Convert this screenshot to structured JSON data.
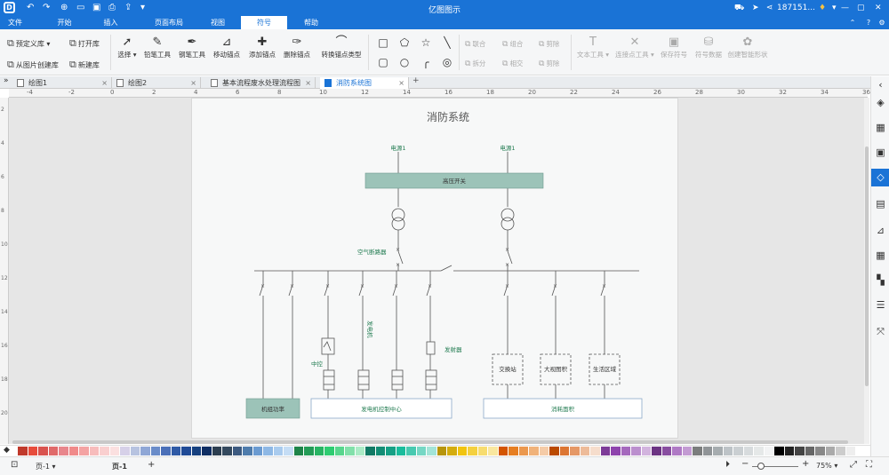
{
  "app": {
    "title": "亿图图示",
    "user": "187151..."
  },
  "menu": [
    "文件",
    "开始",
    "插入",
    "页面布局",
    "视图",
    "符号",
    "帮助"
  ],
  "ribbon": {
    "library": {
      "predefined": "预定义库",
      "open": "打开库",
      "from_image": "从图片创建库",
      "new": "新建库"
    },
    "tools": [
      {
        "label": "选择",
        "icon": "pointer-icon"
      },
      {
        "label": "铅笔工具",
        "icon": "pencil-icon"
      },
      {
        "label": "钢笔工具",
        "icon": "pen-icon"
      },
      {
        "label": "移动锚点",
        "icon": "move-anchor-icon"
      },
      {
        "label": "添加锚点",
        "icon": "add-anchor-icon"
      },
      {
        "label": "删除锚点",
        "icon": "delete-anchor-icon"
      },
      {
        "label": "转换锚点类型",
        "icon": "convert-anchor-icon"
      }
    ],
    "geometry": [
      "联合",
      "组合",
      "剪除",
      "拆分",
      "相交",
      "剪除"
    ],
    "text_tool": "文本工具",
    "connection_tool": "连接点工具",
    "save_symbol": "保存符号",
    "symbol_data": "符号数据",
    "smart_shape": "创建智能形状"
  },
  "tabs": [
    "绘图1",
    "绘图2",
    "基本流程废水处理流程图",
    "消防系统图"
  ],
  "ruler_h": [
    "-4",
    "-2",
    "0",
    "2",
    "4",
    "6",
    "8",
    "10",
    "12",
    "14",
    "16",
    "18",
    "20",
    "22",
    "24",
    "26",
    "28",
    "30",
    "32",
    "34",
    "36"
  ],
  "ruler_v": [
    "2",
    "4",
    "6",
    "8",
    "10",
    "12",
    "14",
    "16",
    "18",
    "20"
  ],
  "diagram": {
    "title": "消防系统",
    "source1": "电源1",
    "source2": "电源1",
    "hv_switch": "高压开关",
    "breaker": "空气断路器",
    "generator": "发电机",
    "control": "中控",
    "transmitter": "发射器",
    "exchange": "交换站",
    "lobby": "大视图积",
    "living": "生活区域",
    "pump_power": "机组功率",
    "gen_center": "发电机控制中心",
    "consumption": "消耗面积"
  },
  "colors": {
    "brand": "#1a73d6",
    "box_fill": "#9cc3b8",
    "line": "#555555",
    "label_green": "#1f7a4f"
  },
  "palette": [
    "#c0392b",
    "#e74c3c",
    "#d9534f",
    "#e06a6a",
    "#e8868c",
    "#f08a8a",
    "#f4a3a3",
    "#f7bcbc",
    "#f9cfcf",
    "#fbe0e0",
    "#d6d0e8",
    "#b7c3e0",
    "#8fa7d6",
    "#6a8cc9",
    "#4a6fb8",
    "#2f5aa6",
    "#1f4a96",
    "#16407f",
    "#0f2e63",
    "#2c3e50",
    "#34495e",
    "#3d5a80",
    "#4f7cac",
    "#6b9bd1",
    "#8eb8e5",
    "#a9cbee",
    "#c5ddf5",
    "#1e8449",
    "#239b56",
    "#28b463",
    "#2ecc71",
    "#58d68d",
    "#82e0aa",
    "#abebc6",
    "#117a65",
    "#138d75",
    "#16a085",
    "#1abc9c",
    "#48c9b0",
    "#76d7c4",
    "#a3e4d7",
    "#b7950b",
    "#d4ac0d",
    "#f1c40f",
    "#f4d03f",
    "#f7dc6f",
    "#f9e79f",
    "#d35400",
    "#e67e22",
    "#eb984e",
    "#f0b27a",
    "#f5cba7",
    "#ba4a00",
    "#dc7633",
    "#e59866",
    "#edbb99",
    "#f6ddcc",
    "#7d3c98",
    "#8e44ad",
    "#a569bd",
    "#bb8fce",
    "#d2b4de",
    "#6c3483",
    "#884ea0",
    "#af7ac5",
    "#c39bd3",
    "#7b7d7d",
    "#909497",
    "#a6acaf",
    "#bdc3c7",
    "#cacfd2",
    "#d7dbdd",
    "#e5e8e8",
    "#f2f3f4",
    "#000000",
    "#222222",
    "#444444",
    "#666666",
    "#888888",
    "#aaaaaa",
    "#cccccc",
    "#eeeeee",
    "#ffffff"
  ],
  "status": {
    "page_name": "页-1",
    "page_tab": "页-1",
    "zoom": "75%"
  }
}
